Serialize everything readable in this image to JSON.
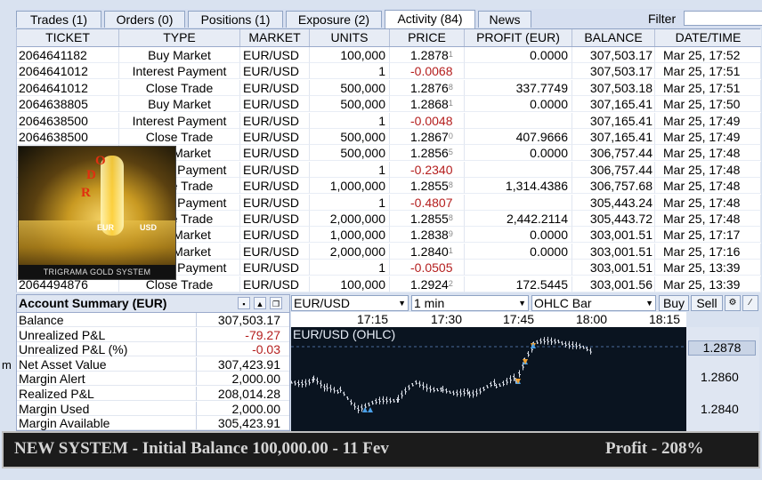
{
  "tabs": [
    {
      "label": "Trades (1)"
    },
    {
      "label": "Orders (0)"
    },
    {
      "label": "Positions (1)"
    },
    {
      "label": "Exposure (2)"
    },
    {
      "label": "Activity (84)"
    },
    {
      "label": "News"
    }
  ],
  "filter": {
    "label": "Filter",
    "value": ""
  },
  "table": {
    "headers": [
      "TICKET",
      "TYPE",
      "MARKET",
      "UNITS",
      "PRICE",
      "PROFIT (EUR)",
      "BALANCE",
      "DATE/TIME"
    ],
    "rows": [
      {
        "ticket": "2064641182",
        "type": "Buy Market",
        "market": "EUR/USD",
        "units": "100,000",
        "price": "1.2878",
        "price_sup": "1",
        "price_neg": false,
        "profit": "0.0000",
        "balance": "307,503.17",
        "datetime": "Mar 25, 17:52"
      },
      {
        "ticket": "2064641012",
        "type": "Interest Payment",
        "market": "EUR/USD",
        "units": "1",
        "price": "-0.0068",
        "price_sup": "",
        "price_neg": true,
        "profit": "",
        "balance": "307,503.17",
        "datetime": "Mar 25, 17:51"
      },
      {
        "ticket": "2064641012",
        "type": "Close Trade",
        "market": "EUR/USD",
        "units": "500,000",
        "price": "1.2876",
        "price_sup": "8",
        "price_neg": false,
        "profit": "337.7749",
        "balance": "307,503.18",
        "datetime": "Mar 25, 17:51"
      },
      {
        "ticket": "2064638805",
        "type": "Buy Market",
        "market": "EUR/USD",
        "units": "500,000",
        "price": "1.2868",
        "price_sup": "1",
        "price_neg": false,
        "profit": "0.0000",
        "balance": "307,165.41",
        "datetime": "Mar 25, 17:50"
      },
      {
        "ticket": "2064638500",
        "type": "Interest Payment",
        "market": "EUR/USD",
        "units": "1",
        "price": "-0.0048",
        "price_sup": "",
        "price_neg": true,
        "profit": "",
        "balance": "307,165.41",
        "datetime": "Mar 25, 17:49"
      },
      {
        "ticket": "2064638500",
        "type": "Close Trade",
        "market": "EUR/USD",
        "units": "500,000",
        "price": "1.2867",
        "price_sup": "0",
        "price_neg": false,
        "profit": "407.9666",
        "balance": "307,165.41",
        "datetime": "Mar 25, 17:49"
      },
      {
        "ticket": "",
        "type": "Buy Market",
        "market": "EUR/USD",
        "units": "500,000",
        "price": "1.2856",
        "price_sup": "5",
        "price_neg": false,
        "profit": "0.0000",
        "balance": "306,757.44",
        "datetime": "Mar 25, 17:48"
      },
      {
        "ticket": "",
        "type": "Interest Payment",
        "market": "EUR/USD",
        "units": "1",
        "price": "-0.2340",
        "price_sup": "",
        "price_neg": true,
        "profit": "",
        "balance": "306,757.44",
        "datetime": "Mar 25, 17:48"
      },
      {
        "ticket": "",
        "type": "Close Trade",
        "market": "EUR/USD",
        "units": "1,000,000",
        "price": "1.2855",
        "price_sup": "8",
        "price_neg": false,
        "profit": "1,314.4386",
        "balance": "306,757.68",
        "datetime": "Mar 25, 17:48"
      },
      {
        "ticket": "",
        "type": "Interest Payment",
        "market": "EUR/USD",
        "units": "1",
        "price": "-0.4807",
        "price_sup": "",
        "price_neg": true,
        "profit": "",
        "balance": "305,443.24",
        "datetime": "Mar 25, 17:48"
      },
      {
        "ticket": "",
        "type": "Close Trade",
        "market": "EUR/USD",
        "units": "2,000,000",
        "price": "1.2855",
        "price_sup": "8",
        "price_neg": false,
        "profit": "2,442.2114",
        "balance": "305,443.72",
        "datetime": "Mar 25, 17:48"
      },
      {
        "ticket": "",
        "type": "Buy Market",
        "market": "EUR/USD",
        "units": "1,000,000",
        "price": "1.2838",
        "price_sup": "9",
        "price_neg": false,
        "profit": "0.0000",
        "balance": "303,001.51",
        "datetime": "Mar 25, 17:17"
      },
      {
        "ticket": "",
        "type": "Buy Market",
        "market": "EUR/USD",
        "units": "2,000,000",
        "price": "1.2840",
        "price_sup": "1",
        "price_neg": false,
        "profit": "0.0000",
        "balance": "303,001.51",
        "datetime": "Mar 25, 17:16"
      },
      {
        "ticket": "",
        "type": "Interest Payment",
        "market": "EUR/USD",
        "units": "1",
        "price": "-0.0505",
        "price_sup": "",
        "price_neg": true,
        "profit": "",
        "balance": "303,001.51",
        "datetime": "Mar 25, 13:39"
      },
      {
        "ticket": "2064494876",
        "type": "Close Trade",
        "market": "EUR/USD",
        "units": "100,000",
        "price": "1.2924",
        "price_sup": "2",
        "price_neg": false,
        "profit": "172.5445",
        "balance": "303,001.56",
        "datetime": "Mar 25, 13:39"
      }
    ]
  },
  "logo": {
    "letters": [
      "O",
      "D",
      "R"
    ],
    "currencies": [
      "EUR",
      "USD"
    ],
    "caption": "TRIGRAMA GOLD SYSTEM"
  },
  "account": {
    "title": "Account Summary (EUR)",
    "rows": [
      {
        "label": "Balance",
        "value": "307,503.17",
        "neg": false
      },
      {
        "label": "Unrealized P&L",
        "value": "-79.27",
        "neg": true
      },
      {
        "label": "Unrealized P&L (%)",
        "value": "-0.03",
        "neg": true
      },
      {
        "label": "Net Asset Value",
        "value": "307,423.91",
        "neg": false
      },
      {
        "label": "Margin Alert",
        "value": "2,000.00",
        "neg": false
      },
      {
        "label": "Realized P&L",
        "value": "208,014.28",
        "neg": false
      },
      {
        "label": "Margin Used",
        "value": "2,000.00",
        "neg": false
      },
      {
        "label": "Margin Available",
        "value": "305,423.91",
        "neg": false
      }
    ]
  },
  "cutoff_text": "m",
  "chart": {
    "instrument": "EUR/USD",
    "interval": "1 min",
    "chart_type": "OHLC Bar",
    "buy_label": "Buy",
    "sell_label": "Sell",
    "time_labels": [
      "17:15",
      "17:30",
      "17:45",
      "18:00",
      "18:15"
    ],
    "title": "EUR/USD (OHLC)",
    "price_labels": [
      "1.2878",
      "1.2860",
      "1.2840"
    ],
    "last_price": "1.2878"
  },
  "banner": {
    "left": "NEW  SYSTEM - Initial Balance 100,000.00 - 11 Fev",
    "right": "Profit - 208%"
  }
}
